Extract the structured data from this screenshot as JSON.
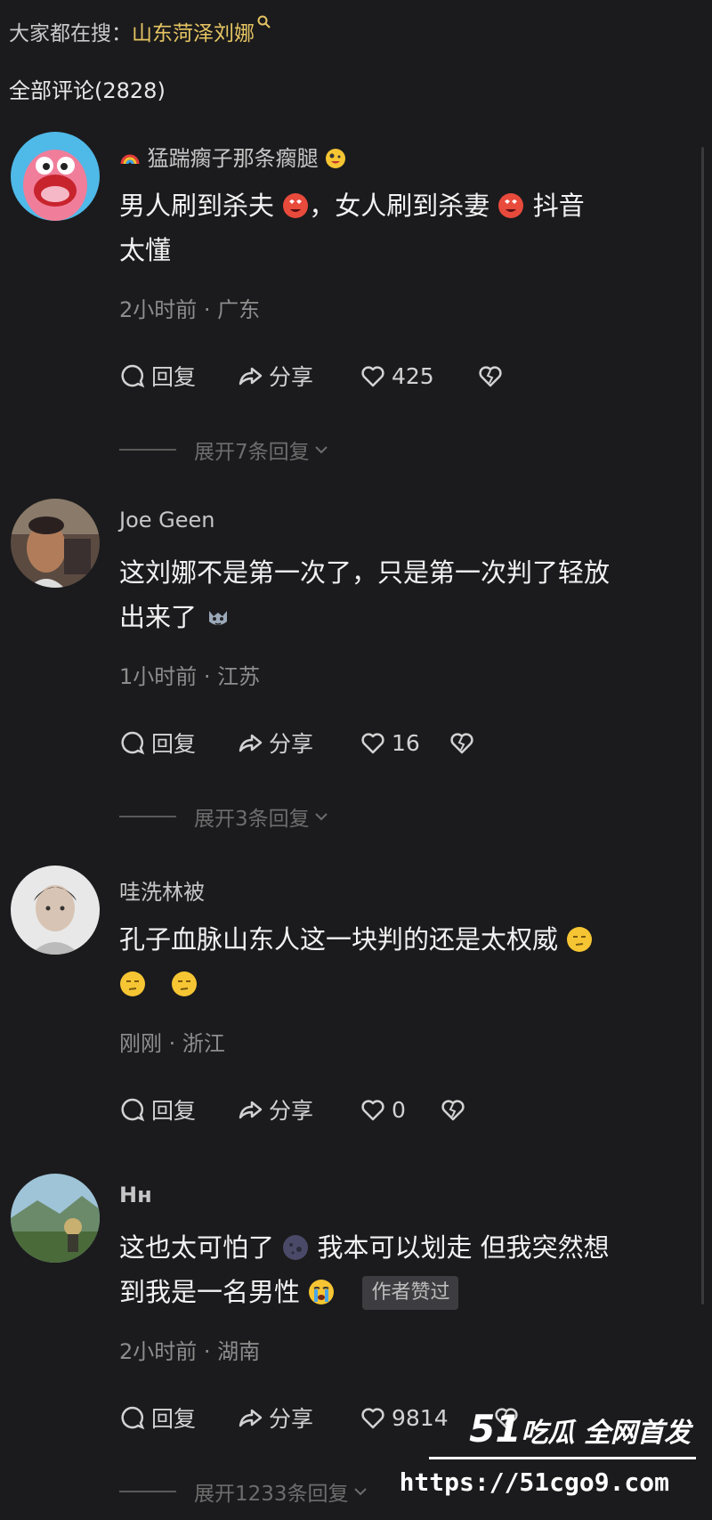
{
  "search": {
    "prefix": "大家都在搜：",
    "keyword": "山东菏泽刘娜"
  },
  "comments_header": "全部评论(2828)",
  "comments": [
    {
      "username": "猛踹瘸子那条瘸腿",
      "text_parts": [
        "男人刷到杀夫",
        "，女人刷到杀妻",
        "抖音",
        "太懂"
      ],
      "time_location": "2小时前 · 广东",
      "reply_label": "回复",
      "share_label": "分享",
      "likes": "425",
      "expand_label": "展开7条回复"
    },
    {
      "username": "Joe Geen",
      "text_parts": [
        "这刘娜不是第一次了，只是第一次判了轻放",
        "出来了"
      ],
      "time_location": "1小时前 · 江苏",
      "reply_label": "回复",
      "share_label": "分享",
      "likes": "16",
      "expand_label": "展开3条回复"
    },
    {
      "username": "哇洗林被",
      "text_parts": [
        "孔子血脉山东人这一块判的还是太权威"
      ],
      "time_location": "刚刚 · 浙江",
      "reply_label": "回复",
      "share_label": "分享",
      "likes": "0"
    },
    {
      "username": "Hн",
      "text_parts": [
        "这也太可怕了",
        "我本可以划走 但我突然想",
        "到我是一名男性"
      ],
      "author_badge": "作者赞过",
      "time_location": "2小时前 · 湖南",
      "reply_label": "回复",
      "share_label": "分享",
      "likes": "9814",
      "expand_label": "展开1233条回复"
    }
  ],
  "watermark": {
    "brand_num": "51",
    "brand_text": "吃瓜 全网首发",
    "url": "https://51cgo9.com"
  },
  "colors": {
    "background": "#1b1b1d",
    "keyword": "#e6c563",
    "meta": "#8d8d8d"
  }
}
